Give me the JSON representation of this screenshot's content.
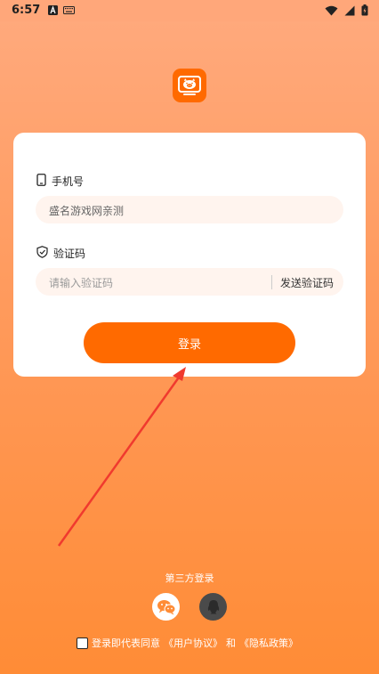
{
  "status_bar": {
    "time": "6:57"
  },
  "login": {
    "phone_label": "手机号",
    "phone_value": "盛名游戏网亲测",
    "code_label": "验证码",
    "code_placeholder": "请输入验证码",
    "send_code": "发送验证码",
    "login_button": "登录"
  },
  "third_party": {
    "title": "第三方登录"
  },
  "agreement": {
    "prefix": "登录即代表同意",
    "user_agreement": "《用户协议》",
    "and": "和",
    "privacy_policy": "《隐私政策》"
  },
  "colors": {
    "accent": "#FF6A00",
    "background_top": "#FFAA7E",
    "background_bottom": "#FF8C36",
    "input_bg": "#FFF4EE",
    "annotation_arrow": "#F03A2E"
  }
}
